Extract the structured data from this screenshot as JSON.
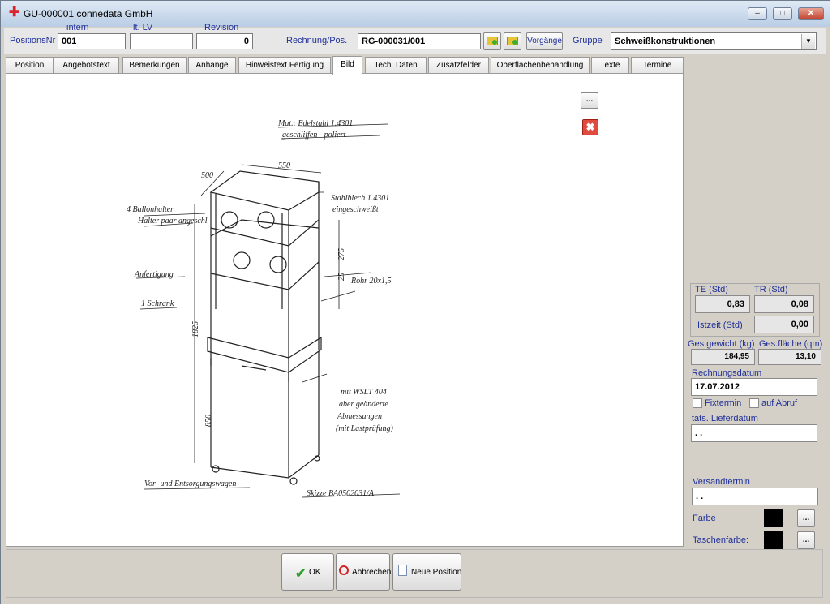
{
  "window": {
    "title": "GU-000001 connedata GmbH"
  },
  "header": {
    "positionsnr_label": "PositionsNr",
    "intern_label": "intern",
    "lt_lv_label": "lt. LV",
    "revision_label": "Revision",
    "intern_value": "001",
    "lt_lv_value": "",
    "revision_value": "0",
    "rechnung_label": "Rechnung/Pos.",
    "rechnung_value": "RG-000031/001",
    "vorgaenge_label": "Vorgänge",
    "gruppe_label": "Gruppe",
    "gruppe_value": "Schweißkonstruktionen"
  },
  "tabs": [
    {
      "label": "Position"
    },
    {
      "label": "Angebotstext"
    },
    {
      "label": "Bemerkungen"
    },
    {
      "label": "Anhänge"
    },
    {
      "label": "Hinweistext Fertigung"
    },
    {
      "label": "Bild"
    },
    {
      "label": "Tech. Daten"
    },
    {
      "label": "Zusatzfelder"
    },
    {
      "label": "Oberflächenbehandlung"
    },
    {
      "label": "Texte"
    },
    {
      "label": "Termine"
    }
  ],
  "active_tab": "Bild",
  "image_tools": {
    "browse_label": "..."
  },
  "side": {
    "te_label": "TE (Std)",
    "tr_label": "TR (Std)",
    "te_value": "0,83",
    "tr_value": "0,08",
    "istzeit_label": "Istzeit (Std)",
    "istzeit_value": "0,00",
    "gewicht_label": "Ges.gewicht (kg)",
    "flaeche_label": "Ges.fläche (qm)",
    "gewicht_value": "184,95",
    "flaeche_value": "13,10",
    "rechnungsdatum_label": "Rechnungsdatum",
    "rechnungsdatum_value": "17.07.2012",
    "fixtermin_label": "Fixtermin",
    "aufabruf_label": "auf Abruf",
    "lieferdatum_label": "tats. Lieferdatum",
    "lieferdatum_value": ". .",
    "versandtermin_label": "Versandtermin",
    "versandtermin_value": ". .",
    "farbe_label": "Farbe",
    "taschenfarbe_label": "Taschenfarbe:",
    "color_browse": "..."
  },
  "drawing": {
    "material_note_1": "Mat.: Edelstahl 1.4301",
    "material_note_2": "geschliffen - poliert",
    "dim_width": "550",
    "dim_depth": "500",
    "note_left_1": "4 Ballonhalter",
    "note_left_2": "Halter paar angeschl.",
    "note_left_3": "Anfertigung",
    "note_left_4": "1 Schrank",
    "note_right_1": "Stahlblech 1.4301",
    "note_right_2": "eingeschweißt",
    "note_right_3": "Rohr 20x1,5",
    "note_right_4": "mit WSLT 404",
    "note_right_5": "aber geänderte",
    "note_right_6": "Abmessungen",
    "note_right_7": "(mit Lastprüfung)",
    "note_bottom_left": "Vor- und Entsorgungswagen",
    "note_bottom_right": "Skizze BA0502031/A",
    "dim_height": "1825",
    "dim_lower": "850",
    "dim_shelf": "275",
    "dim_shelf2": "25"
  },
  "buttons": {
    "ok": "OK",
    "abbrechen": "Abbrechen",
    "neue_position": "Neue Position"
  },
  "colors": {
    "label_blue": "#1f2f9a",
    "ok_green": "#2f9e2f",
    "cancel_red": "#d42222"
  }
}
